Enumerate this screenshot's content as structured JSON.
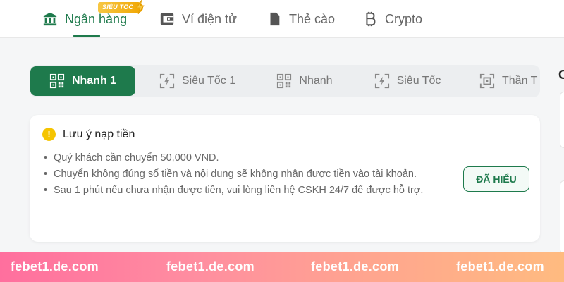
{
  "top_tabs": [
    {
      "label": "Ngân hàng",
      "icon": "bank-icon",
      "active": true
    },
    {
      "label": "Ví điện tử",
      "icon": "wallet-icon",
      "active": false
    },
    {
      "label": "Thẻ cào",
      "icon": "sim-card-icon",
      "active": false
    },
    {
      "label": "Crypto",
      "icon": "bitcoin-icon",
      "active": false
    }
  ],
  "fast_badge": "SIÊU TỐC",
  "methods": [
    {
      "label": "Nhanh 1",
      "icon": "qr-icon",
      "active": true
    },
    {
      "label": "Siêu Tốc 1",
      "icon": "fast-scan-icon",
      "active": false
    },
    {
      "label": "Nhanh",
      "icon": "qr-icon",
      "active": false
    },
    {
      "label": "Siêu Tốc",
      "icon": "fast-scan-icon",
      "active": false
    },
    {
      "label": "Thần T",
      "icon": "scan-frame-icon",
      "active": false
    }
  ],
  "notice": {
    "title": "Lưu ý nạp tiền",
    "items": [
      "Quý khách cần chuyển 50,000 VND.",
      "Chuyển không đúng số tiền và nội dung sẽ không nhận được tiền vào tài khoản.",
      "Sau 1 phút nếu chưa nhận được tiền, vui lòng liên hệ CSKH 24/7 để được hỗ trợ."
    ],
    "button": "ĐÃ HIỂU"
  },
  "side_peek": "C",
  "watermark": [
    "febet1.de.com",
    "febet1.de.com",
    "febet1.de.com",
    "febet1.de.com"
  ],
  "colors": {
    "accent": "#1e7a4c",
    "warning": "#f5c400",
    "badge": "#f0a500"
  }
}
